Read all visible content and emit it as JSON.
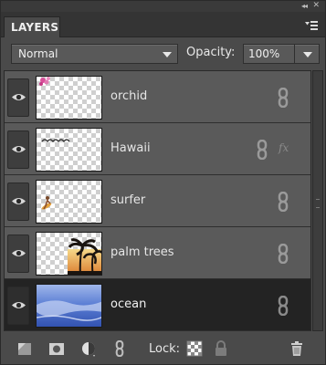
{
  "panel": {
    "tab_title": "LAYERS",
    "collapse_glyph": "◂◂",
    "close_glyph": "✕"
  },
  "options": {
    "blend_mode": "Normal",
    "opacity_label": "Opacity:",
    "opacity_value": "100%"
  },
  "layers": [
    {
      "name": "orchid",
      "visible": true,
      "linked": true,
      "effects": false,
      "selected": false
    },
    {
      "name": "Hawaii",
      "visible": true,
      "linked": true,
      "effects": true,
      "selected": false
    },
    {
      "name": "surfer",
      "visible": true,
      "linked": true,
      "effects": false,
      "selected": false
    },
    {
      "name": "palm trees",
      "visible": true,
      "linked": true,
      "effects": false,
      "selected": false
    },
    {
      "name": "ocean",
      "visible": true,
      "linked": true,
      "effects": false,
      "selected": true
    }
  ],
  "effects_glyph": "fx",
  "bottom": {
    "lock_label": "Lock:"
  },
  "icons": {
    "eye": "eye-icon",
    "link": "link-icon",
    "new_layer": "new-layer-icon",
    "mask": "layer-mask-icon",
    "adjustment": "adjustment-layer-icon",
    "link_layers": "link-layers-icon",
    "lock_transparent": "lock-transparent-pixels-icon",
    "lock_all": "lock-all-icon",
    "trash": "trash-icon",
    "panel_menu": "panel-menu-icon"
  },
  "colors": {
    "panel_bg": "#4a4a4a",
    "row_bg": "#5a5a5a",
    "selected_row_bg": "#232323",
    "text": "#e6e6e6"
  }
}
